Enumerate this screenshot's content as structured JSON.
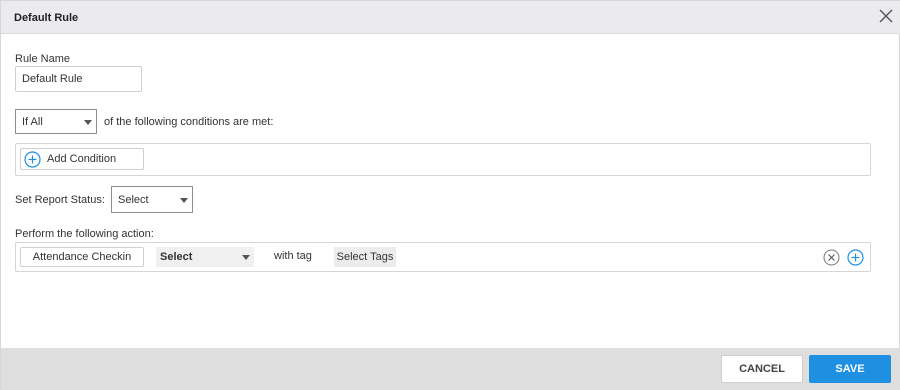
{
  "dialog": {
    "title": "Default Rule"
  },
  "rule_name": {
    "label": "Rule Name",
    "value": "Default Rule"
  },
  "condition_match": {
    "selected": "If All",
    "suffix": "of the following conditions are met:"
  },
  "conditions": {
    "add_label": "Add Condition"
  },
  "report_status": {
    "label": "Set Report Status:",
    "selected": "Select"
  },
  "actions": {
    "label": "Perform the following action:",
    "rows": [
      {
        "name": "Attendance Checkin",
        "select": "Select",
        "with_tag": "with tag",
        "tags": "Select Tags"
      }
    ]
  },
  "footer": {
    "cancel_label": "CANCEL",
    "save_label": "SAVE"
  },
  "colors": {
    "accent": "#1e8fe1",
    "header_bg": "#ebebef",
    "footer_bg": "#dedede"
  }
}
